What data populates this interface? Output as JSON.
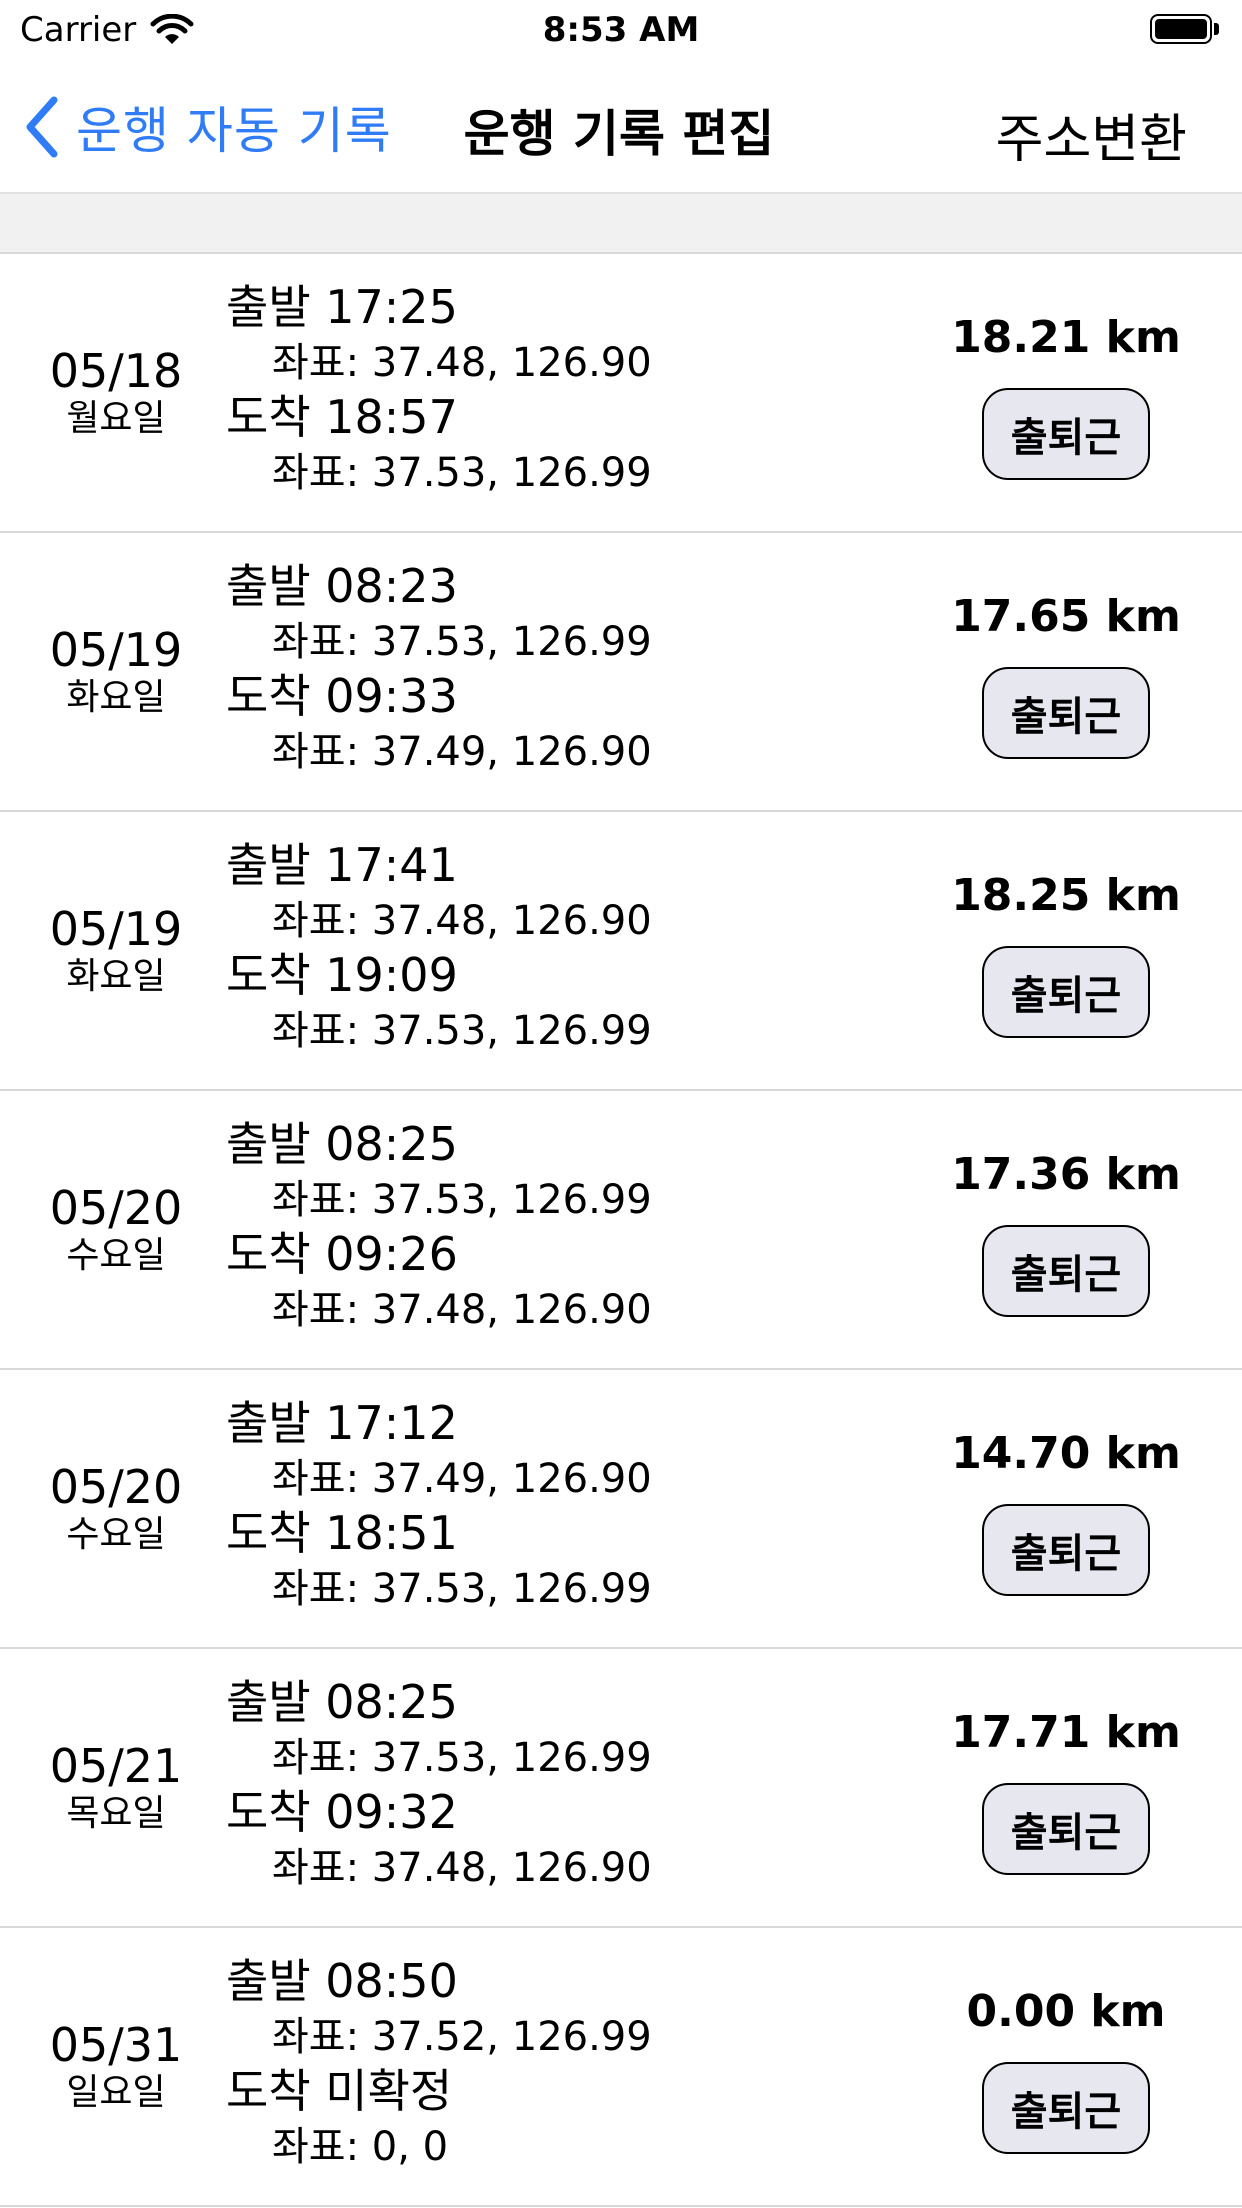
{
  "status_bar": {
    "carrier": "Carrier",
    "time": "8:53 AM"
  },
  "nav": {
    "back_label": "운행 자동 기록",
    "title": "운행 기록 편집",
    "action_label": "주소변환"
  },
  "labels": {
    "depart": "출발",
    "arrive": "도착",
    "coord": "좌표:"
  },
  "trips": [
    {
      "date": "05/18",
      "weekday": "월요일",
      "depart_time": "17:25",
      "depart_coord": "37.48, 126.90",
      "arrive_time": "18:57",
      "arrive_coord": "37.53, 126.99",
      "distance": "18.21 km",
      "type": "출퇴근"
    },
    {
      "date": "05/19",
      "weekday": "화요일",
      "depart_time": "08:23",
      "depart_coord": "37.53, 126.99",
      "arrive_time": "09:33",
      "arrive_coord": "37.49, 126.90",
      "distance": "17.65 km",
      "type": "출퇴근"
    },
    {
      "date": "05/19",
      "weekday": "화요일",
      "depart_time": "17:41",
      "depart_coord": "37.48, 126.90",
      "arrive_time": "19:09",
      "arrive_coord": "37.53, 126.99",
      "distance": "18.25 km",
      "type": "출퇴근"
    },
    {
      "date": "05/20",
      "weekday": "수요일",
      "depart_time": "08:25",
      "depart_coord": "37.53, 126.99",
      "arrive_time": "09:26",
      "arrive_coord": "37.48, 126.90",
      "distance": "17.36 km",
      "type": "출퇴근"
    },
    {
      "date": "05/20",
      "weekday": "수요일",
      "depart_time": "17:12",
      "depart_coord": "37.49, 126.90",
      "arrive_time": "18:51",
      "arrive_coord": "37.53, 126.99",
      "distance": "14.70 km",
      "type": "출퇴근"
    },
    {
      "date": "05/21",
      "weekday": "목요일",
      "depart_time": "08:25",
      "depart_coord": "37.53, 126.99",
      "arrive_time": "09:32",
      "arrive_coord": "37.48, 126.90",
      "distance": "17.71 km",
      "type": "출퇴근"
    },
    {
      "date": "05/31",
      "weekday": "일요일",
      "depart_time": "08:50",
      "depart_coord": "37.52, 126.99",
      "arrive_time": "미확정",
      "arrive_coord": "0, 0",
      "distance": "0.00 km",
      "type": "출퇴근"
    }
  ],
  "colors": {
    "accent": "#2f7cf6",
    "button_bg": "#e6e7ef",
    "separator": "#d9d9db",
    "section_bg": "#f1f1f2"
  },
  "icons": {
    "back": "chevron-left-icon",
    "wifi": "wifi-icon",
    "battery": "battery-icon"
  }
}
